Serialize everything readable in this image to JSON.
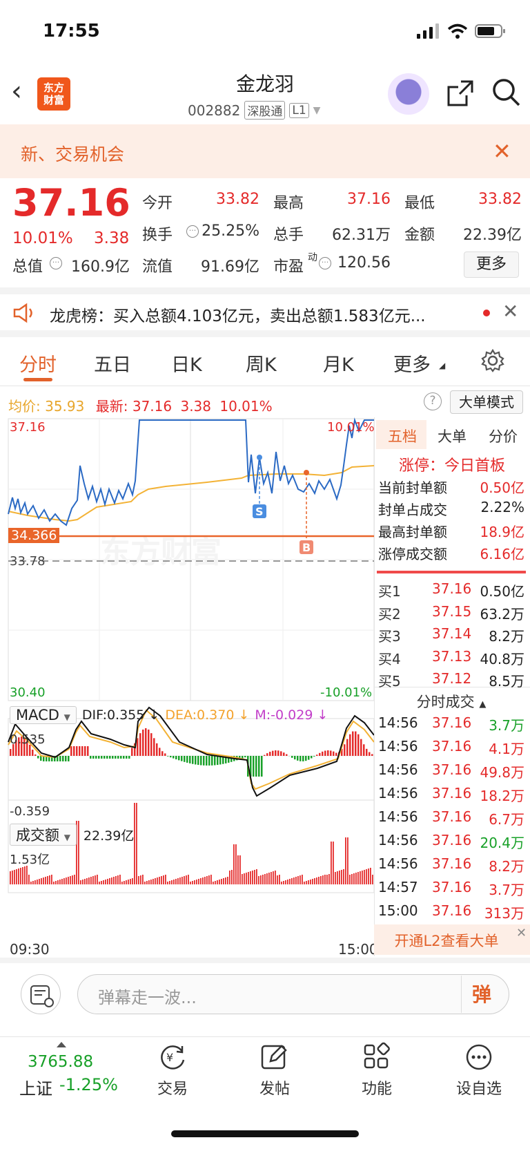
{
  "status": {
    "time": "17:55"
  },
  "header": {
    "logo_line1": "东方",
    "logo_line2": "财富",
    "stock_name": "金龙羽",
    "stock_code": "002882",
    "market_tag": "深股通",
    "level_tag": "L1"
  },
  "banner": {
    "text": "新、交易机会"
  },
  "quote": {
    "price": "37.16",
    "change_pct": "10.01%",
    "change": "3.38",
    "fields": [
      {
        "label": "今开",
        "value": "33.82",
        "color": "#e42a2a"
      },
      {
        "label": "最高",
        "value": "37.16",
        "color": "#e42a2a"
      },
      {
        "label": "最低",
        "value": "33.82",
        "color": "#e42a2a"
      },
      {
        "label": "换手",
        "value": "25.25%",
        "color": "#333333"
      },
      {
        "label": "总手",
        "value": "62.31万",
        "color": "#333333"
      },
      {
        "label": "金额",
        "value": "22.39亿",
        "color": "#333333"
      },
      {
        "label": "总值",
        "value": "160.9亿",
        "color": "#333333"
      },
      {
        "label": "流值",
        "value": "91.69亿",
        "color": "#333333"
      },
      {
        "label": "市盈",
        "value": "120.56",
        "color": "#333333"
      }
    ],
    "pe_sup": "动",
    "more_label": "更多"
  },
  "lhb": {
    "text": "龙虎榜：买入总额4.103亿元，卖出总额1.583亿元..."
  },
  "tabs": [
    "分时",
    "五日",
    "日K",
    "周K",
    "月K",
    "更多"
  ],
  "intraday": {
    "avg_label": "均价:",
    "avg_value": "35.93",
    "last_label": "最新:",
    "last_value": "37.16",
    "last_change": "3.38",
    "last_pct": "10.01%",
    "big_order_mode": "大单模式",
    "y_top": "37.16",
    "y_bottom": "30.40",
    "pct_top": "10.01%",
    "pct_bottom": "-10.01%",
    "cost_line": "34.366",
    "prev_close": "33.78",
    "marker_s": "S",
    "marker_b": "B",
    "time_start": "09:30",
    "time_end": "15:00",
    "watermark": "东方财富"
  },
  "macd": {
    "name": "MACD",
    "dif": "DIF:0.355 ↓",
    "dea": "DEA:0.370 ↓",
    "m": "M:-0.029 ↓",
    "top": "0.535",
    "bottom": "-0.359"
  },
  "volume": {
    "name": "成交额",
    "total": "22.39亿",
    "max": "1.53亿"
  },
  "right_panel": {
    "tabs": [
      "五档",
      "大单",
      "分价"
    ],
    "limit_up": "涨停：今日首板",
    "limit_stats": [
      {
        "label": "当前封单额",
        "value": "0.50亿",
        "color": "#e42a2a"
      },
      {
        "label": "封单占成交",
        "value": "2.22%",
        "color": "#222222"
      },
      {
        "label": "最高封单额",
        "value": "18.9亿",
        "color": "#e42a2a"
      },
      {
        "label": "涨停成交额",
        "value": "6.16亿",
        "color": "#e42a2a"
      }
    ],
    "order_book": [
      {
        "label": "买1",
        "price": "37.16",
        "vol": "0.50亿"
      },
      {
        "label": "买2",
        "price": "37.15",
        "vol": "63.2万"
      },
      {
        "label": "买3",
        "price": "37.14",
        "vol": "8.2万"
      },
      {
        "label": "买4",
        "price": "37.13",
        "vol": "40.8万"
      },
      {
        "label": "买5",
        "price": "37.12",
        "vol": "8.5万"
      }
    ],
    "ticks_title": "分时成交",
    "ticks": [
      {
        "time": "14:56",
        "price": "37.16",
        "vol": "3.7万",
        "color": "#18a028"
      },
      {
        "time": "14:56",
        "price": "37.16",
        "vol": "4.1万",
        "color": "#e42a2a"
      },
      {
        "time": "14:56",
        "price": "37.16",
        "vol": "49.8万",
        "color": "#e42a2a"
      },
      {
        "time": "14:56",
        "price": "37.16",
        "vol": "18.2万",
        "color": "#e42a2a"
      },
      {
        "time": "14:56",
        "price": "37.16",
        "vol": "6.7万",
        "color": "#e42a2a"
      },
      {
        "time": "14:56",
        "price": "37.16",
        "vol": "20.4万",
        "color": "#18a028"
      },
      {
        "time": "14:56",
        "price": "37.16",
        "vol": "8.2万",
        "color": "#e42a2a"
      },
      {
        "time": "14:57",
        "price": "37.16",
        "vol": "3.7万",
        "color": "#e42a2a"
      },
      {
        "time": "15:00",
        "price": "37.16",
        "vol": "313万",
        "color": "#e42a2a"
      }
    ],
    "l2_banner": "开通L2查看大单"
  },
  "danmaku": {
    "placeholder": "弹幕走一波...",
    "send_label": "弹"
  },
  "bottom_nav": {
    "index_value": "3765.88",
    "index_name": "上证",
    "index_change": "-1.25%",
    "items": [
      "交易",
      "发帖",
      "功能",
      "设自选"
    ]
  }
}
